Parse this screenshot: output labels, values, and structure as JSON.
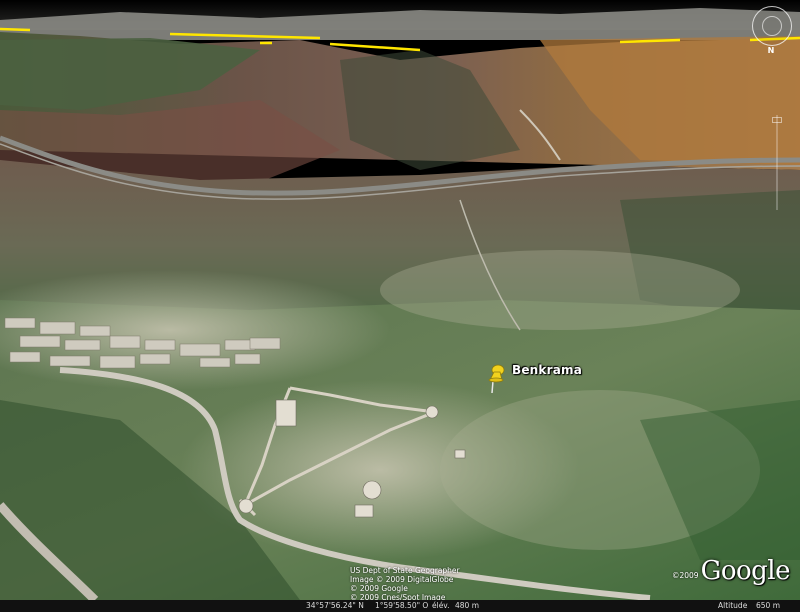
{
  "placemark": {
    "label": "Benkrama",
    "icon": "yellow-pushpin-icon"
  },
  "attribution": [
    "US Dept of State Geographer",
    "Image © 2009 DigitalGlobe",
    "© 2009 Google",
    "© 2009 Cnes/Spot Image"
  ],
  "logo": {
    "year": "©2009",
    "text": "Google"
  },
  "status_bar": {
    "latitude": "34°57'56.24\" N",
    "longitude": "1°59'58.50\" O",
    "elevation_label": "élév.",
    "elevation_value": "480 m",
    "altitude_label": "Altitude",
    "altitude_value": "650 m"
  },
  "navigation": {
    "north_label": "N"
  },
  "colors": {
    "placemark_pin": "#f2d21e",
    "road_overlay": "#ffe600",
    "status_bar": "#111111"
  }
}
